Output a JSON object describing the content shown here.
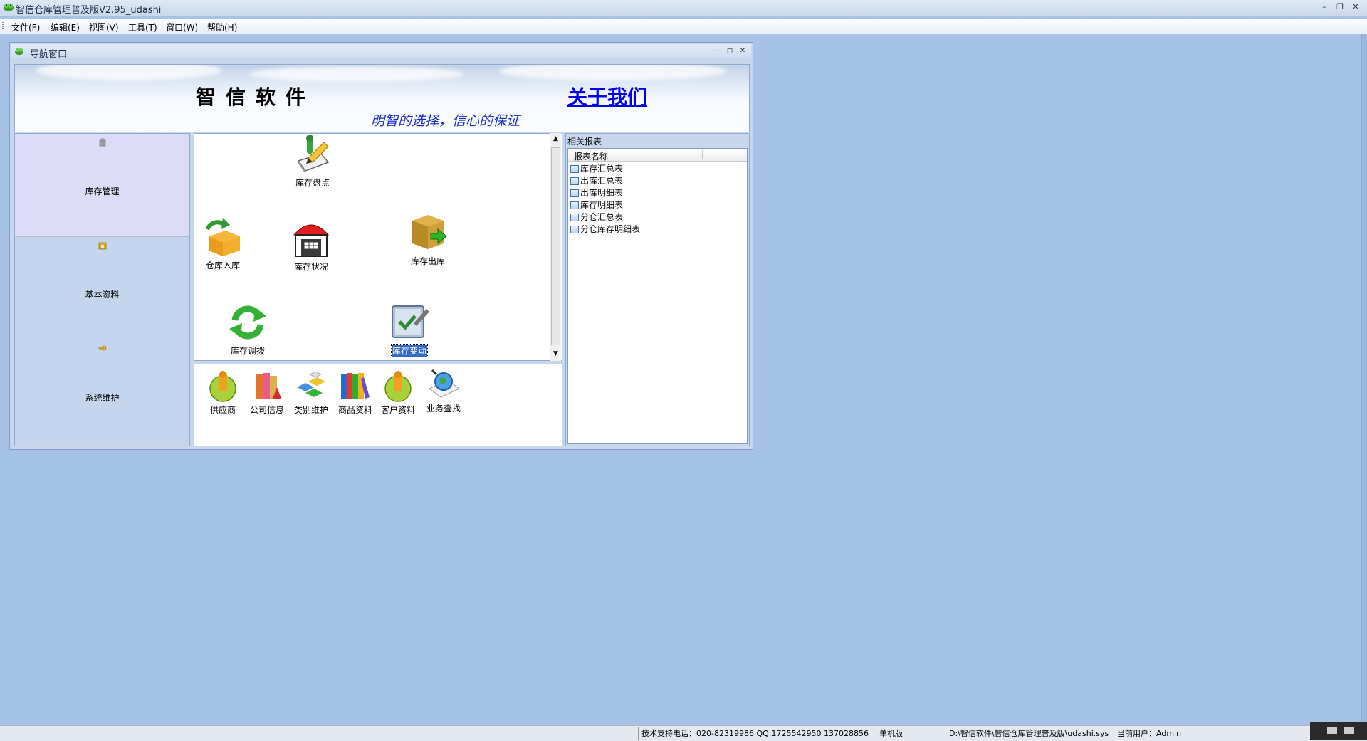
{
  "app": {
    "title": "智信仓库管理普及版V2.95_udashi",
    "controls": {
      "minimize": "–",
      "restore": "❐",
      "close": "✕"
    }
  },
  "menu": {
    "items": [
      {
        "label": "文件(F)"
      },
      {
        "label": "编辑(E)"
      },
      {
        "label": "视图(V)"
      },
      {
        "label": "工具(T)"
      },
      {
        "label": "窗口(W)"
      },
      {
        "label": "帮助(H)"
      }
    ]
  },
  "nav_window": {
    "title": "导航窗口",
    "controls": {
      "minimize": "—",
      "restore": "◻",
      "close": "✕"
    },
    "banner": {
      "brand": "智信软件",
      "about_link": "关于我们",
      "slogan": "明智的选择，信心的保证"
    },
    "left_bar": {
      "items": [
        {
          "label": "库存管理",
          "icon": "inventory-small-icon",
          "active": true
        },
        {
          "label": "基本资料",
          "icon": "folder-small-icon",
          "active": false
        },
        {
          "label": "系统维护",
          "icon": "key-small-icon",
          "active": false
        }
      ]
    },
    "main_icons": {
      "inventory_check": "库存盘点",
      "warehouse_in": "仓库入库",
      "inventory_status": "库存状况",
      "inventory_out": "库存出库",
      "inventory_transfer": "库存调拨",
      "inventory_change": "库存变动"
    },
    "bottom_icons": {
      "items": [
        {
          "label": "供应商",
          "icon": "supplier-icon"
        },
        {
          "label": "公司信息",
          "icon": "company-books-icon"
        },
        {
          "label": "类别维护",
          "icon": "category-blocks-icon"
        },
        {
          "label": "商品资料",
          "icon": "goods-books-icon"
        },
        {
          "label": "客户资料",
          "icon": "customer-icon"
        },
        {
          "label": "业务查找",
          "icon": "search-globe-icon"
        }
      ]
    },
    "reports": {
      "title": "相关报表",
      "column_header": "报表名称",
      "items": [
        {
          "label": "库存汇总表"
        },
        {
          "label": "出库汇总表"
        },
        {
          "label": "出库明细表"
        },
        {
          "label": "库存明细表"
        },
        {
          "label": "分仓汇总表"
        },
        {
          "label": "分仓库存明细表"
        }
      ]
    }
  },
  "status_bar": {
    "support": "技术支持电话：020-82319986 QQ:1725542950 137028856",
    "edition": "单机版",
    "path": "D:\\智信软件\\智信仓库管理普及版\\udashi.sys",
    "user": "当前用户：Admin"
  }
}
